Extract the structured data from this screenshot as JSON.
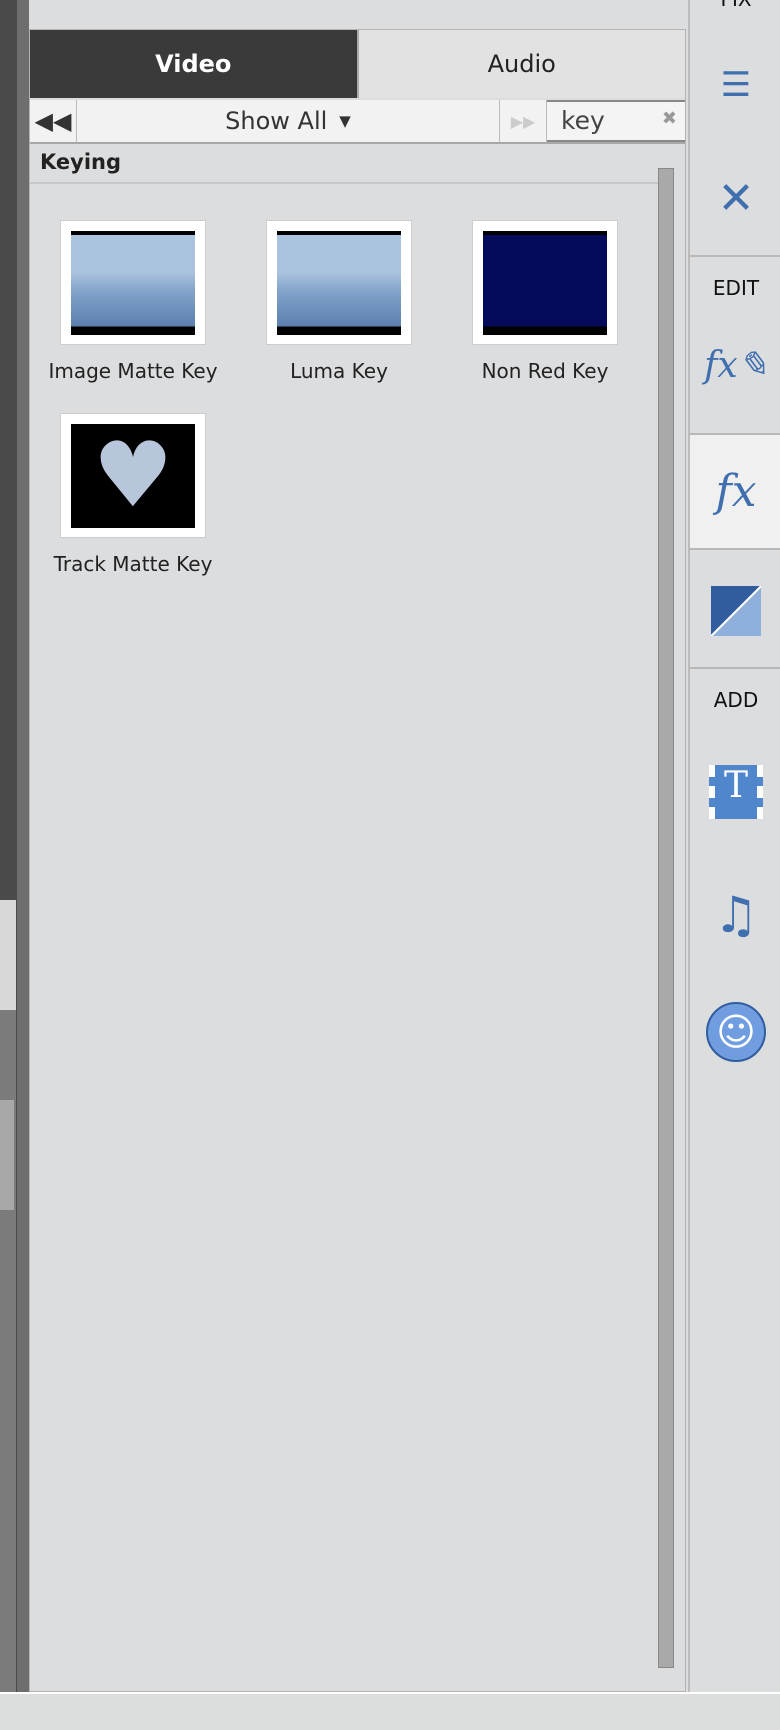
{
  "tabs": [
    {
      "label": "Video",
      "active": true
    },
    {
      "label": "Audio",
      "active": false
    }
  ],
  "toolbar": {
    "prev_icon": "rewind-icon",
    "filter": "Show All",
    "next_icon": "fast-forward-icon",
    "search_value": "key",
    "clear_icon": "clear-icon"
  },
  "section": {
    "title": "Keying"
  },
  "effects": [
    {
      "label": "Image Matte Key"
    },
    {
      "label": "Luma Key"
    },
    {
      "label": "Non Red Key"
    },
    {
      "label": "Track Matte Key"
    }
  ],
  "sidebar": {
    "edit_label": "EDIT",
    "add_label": "ADD",
    "top_cut_label": "FIX"
  },
  "colors": {
    "accent": "#3f6fae",
    "active_tab": "#3a3a3a"
  }
}
